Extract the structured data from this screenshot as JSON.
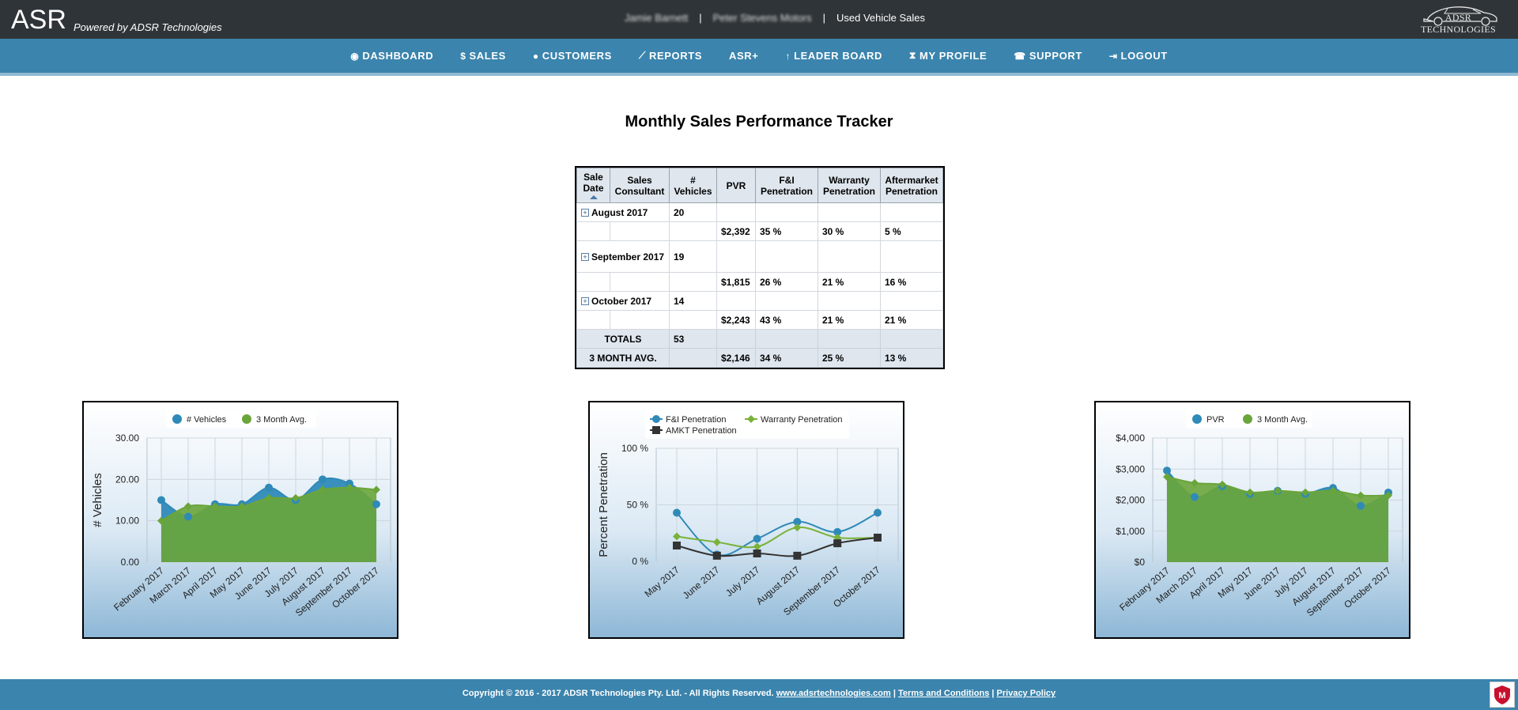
{
  "header": {
    "brand": "ASR",
    "powered_by": "Powered by ADSR Technologies",
    "user_name": "Jamie Barnett",
    "dealer_name": "Peter Stevens Motors",
    "section": "Used Vehicle Sales",
    "logo_text": "ADSR TECHNOLOGIES"
  },
  "nav": [
    {
      "icon": "dashboard-icon",
      "glyph": "◉",
      "label": "DASHBOARD"
    },
    {
      "icon": "dollar-icon",
      "glyph": "$",
      "label": "SALES"
    },
    {
      "icon": "users-icon",
      "glyph": "●",
      "label": "CUSTOMERS"
    },
    {
      "icon": "line-chart-icon",
      "glyph": "⟋",
      "label": "REPORTS"
    },
    {
      "icon": "",
      "glyph": "",
      "label": "ASR+"
    },
    {
      "icon": "up-arrow-icon",
      "glyph": "↑",
      "label": "LEADER BOARD"
    },
    {
      "icon": "person-icon",
      "glyph": "⧗",
      "label": "MY PROFILE"
    },
    {
      "icon": "phone-icon",
      "glyph": "☎",
      "label": "SUPPORT"
    },
    {
      "icon": "logout-icon",
      "glyph": "⇥",
      "label": "LOGOUT"
    }
  ],
  "page_title": "Monthly Sales Performance Tracker",
  "table": {
    "headers": [
      "Sale Date",
      "Sales Consultant",
      "# Vehicles",
      "PVR",
      "F&I Penetration",
      "Warranty Penetration",
      "Aftermarket Penetration"
    ],
    "groups": [
      {
        "label": "August 2017",
        "vehicles": "20",
        "pvr": "$2,392",
        "fi": "35 %",
        "warranty": "30 %",
        "aftermarket": "5 %"
      },
      {
        "label": "September 2017",
        "vehicles": "19",
        "pvr": "$1,815",
        "fi": "26 %",
        "warranty": "21 %",
        "aftermarket": "16 %"
      },
      {
        "label": "October 2017",
        "vehicles": "14",
        "pvr": "$2,243",
        "fi": "43 %",
        "warranty": "21 %",
        "aftermarket": "21 %"
      }
    ],
    "totals": {
      "label": "TOTALS",
      "vehicles": "53"
    },
    "avg": {
      "label": "3 MONTH AVG.",
      "pvr": "$2,146",
      "fi": "34 %",
      "warranty": "25 %",
      "aftermarket": "13 %"
    }
  },
  "chart_data": [
    {
      "type": "area",
      "categories": [
        "February 2017",
        "March 2017",
        "April 2017",
        "May 2017",
        "June 2017",
        "July 2017",
        "August 2017",
        "September 2017",
        "October 2017"
      ],
      "series": [
        {
          "name": "# Vehicles",
          "values": [
            15,
            11,
            14,
            14,
            18,
            15,
            20,
            19,
            14
          ],
          "color": "#2f8ab8"
        },
        {
          "name": "3 Month Avg.",
          "values": [
            10,
            13.5,
            13.5,
            13.5,
            15.5,
            15.5,
            17.5,
            18,
            17.5
          ],
          "color": "#6aa53a"
        }
      ],
      "ylabel": "# Vehicles",
      "yticks": [
        "0.00",
        "10.00",
        "20.00",
        "30.00"
      ],
      "ylim": [
        0,
        30
      ]
    },
    {
      "type": "line",
      "categories": [
        "May 2017",
        "June 2017",
        "July 2017",
        "August 2017",
        "September 2017",
        "October 2017"
      ],
      "series": [
        {
          "name": "F&I Penetration",
          "values": [
            43,
            6,
            20,
            35,
            26,
            43
          ],
          "color": "#2f8ab8",
          "marker": "circle"
        },
        {
          "name": "Warranty Penetration",
          "values": [
            22,
            17,
            13,
            30,
            21,
            21
          ],
          "color": "#79b23a",
          "marker": "diamond"
        },
        {
          "name": "AMKT Penetration",
          "values": [
            14,
            5,
            7,
            5,
            16,
            21
          ],
          "color": "#333333",
          "marker": "square"
        }
      ],
      "ylabel": "Percent Penetration",
      "yticks": [
        "0 %",
        "50 %",
        "100 %"
      ],
      "ylim": [
        0,
        100
      ]
    },
    {
      "type": "area",
      "categories": [
        "February 2017",
        "March 2017",
        "April 2017",
        "May 2017",
        "June 2017",
        "July 2017",
        "August 2017",
        "September 2017",
        "October 2017"
      ],
      "series": [
        {
          "name": "PVR",
          "values": [
            2950,
            2100,
            2450,
            2200,
            2300,
            2200,
            2392,
            1815,
            2243
          ],
          "color": "#2f8ab8"
        },
        {
          "name": "3 Month Avg.",
          "values": [
            2750,
            2550,
            2500,
            2250,
            2300,
            2250,
            2300,
            2150,
            2150
          ],
          "color": "#6aa53a"
        }
      ],
      "ylabel": "",
      "yticks": [
        "$0",
        "$1,000",
        "$2,000",
        "$3,000",
        "$4,000"
      ],
      "ylim": [
        0,
        4000
      ]
    }
  ],
  "footer": {
    "copyright": "Copyright © 2016 - 2017 ADSR Technologies Pty. Ltd. - All Rights Reserved.",
    "site_link": "www.adsrtechnologies.com",
    "terms_link": "Terms and Conditions",
    "privacy_link": "Privacy Policy",
    "separator": "|"
  }
}
